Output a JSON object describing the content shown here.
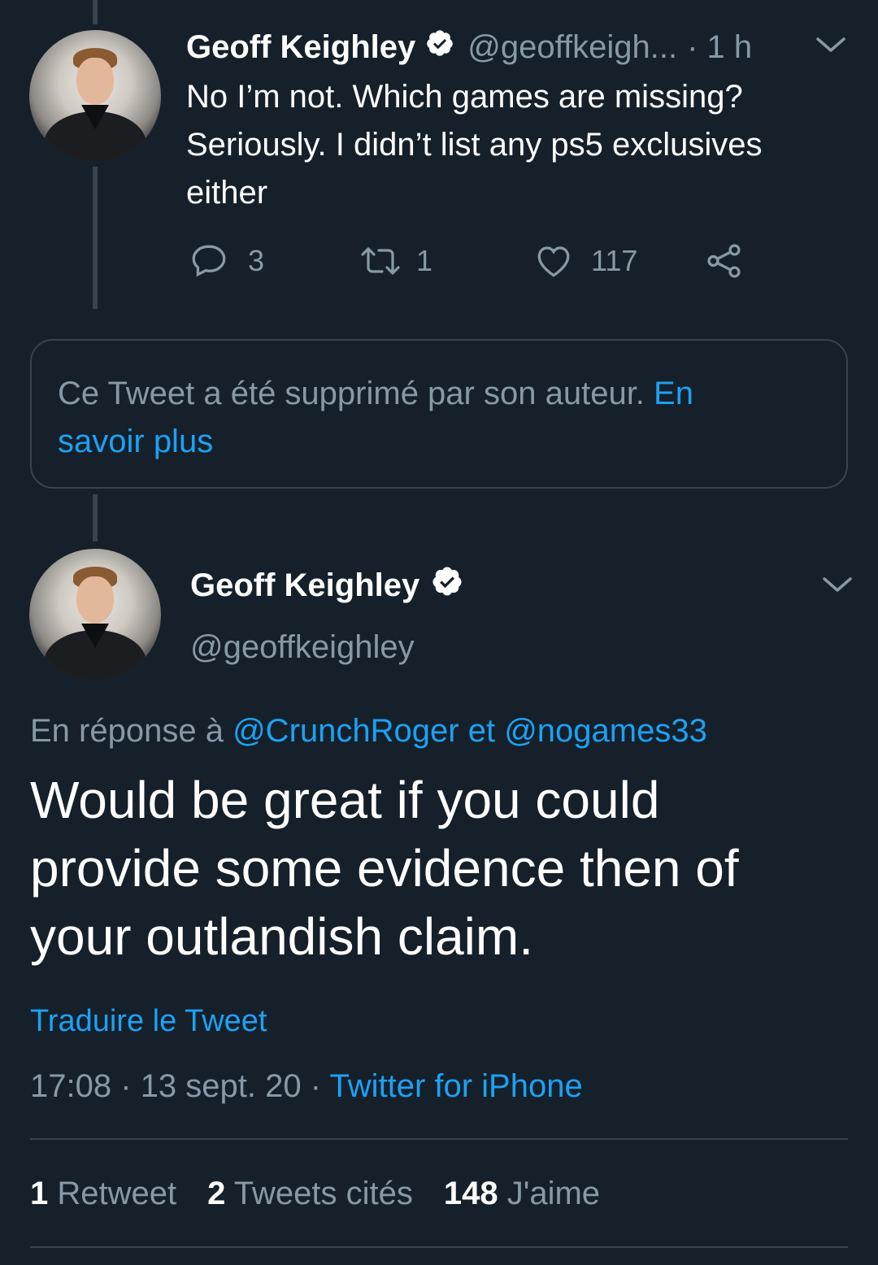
{
  "tweet1": {
    "name": "Geoff Keighley",
    "handle": "@geoffkeigh...",
    "time": "· 1 h",
    "text_line1": "No I’m not. Which games are missing?",
    "text_line2": "Seriously. I didn’t list any ps5 exclusives",
    "text_line3": "either",
    "reply_count": "3",
    "retweet_count": "1",
    "like_count": "117"
  },
  "deleted": {
    "text": "Ce Tweet a été supprimé par son auteur.",
    "link1": "En",
    "link2": "savoir plus"
  },
  "tweet2": {
    "name": "Geoff Keighley",
    "handle": "@geoffkeighley",
    "reply_prefix": "En réponse à",
    "mention1": "@CrunchRoger",
    "conj": "et",
    "mention2": "@nogames33",
    "text_line1": "Would be great if you could",
    "text_line2": "provide some evidence then of",
    "text_line3": "your outlandish claim.",
    "translate": "Traduire le Tweet",
    "time": "17:08",
    "date": "13 sept. 20",
    "source": "Twitter for iPhone"
  },
  "stats": {
    "retweets_num": "1",
    "retweets_label": "Retweet",
    "quotes_num": "2",
    "quotes_label": "Tweets cités",
    "likes_num": "148",
    "likes_label": "J'aime"
  },
  "colors": {
    "background": "#15202b",
    "accent": "#1da1f2",
    "muted": "#8899a6",
    "border": "#38444d"
  }
}
